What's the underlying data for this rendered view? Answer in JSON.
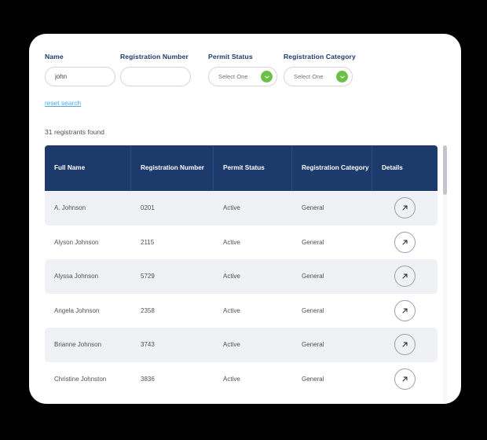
{
  "search": {
    "fields": [
      {
        "label": "Name",
        "type": "text",
        "value": "john",
        "placeholder": ""
      },
      {
        "label": "Registration Number",
        "type": "text",
        "value": "",
        "placeholder": ""
      },
      {
        "label": "Permit Status",
        "type": "select",
        "value": "Select One"
      },
      {
        "label": "Registration Category",
        "type": "select",
        "value": "Select One"
      }
    ],
    "reset_label": "reset search"
  },
  "results": {
    "count_text": "31 registrants found",
    "columns": [
      "Full Name",
      "Registration Number",
      "Permit Status",
      "Registration Category",
      "Details"
    ],
    "rows": [
      {
        "full_name": "A. Johnson",
        "registration_number": "0201",
        "permit_status": "Active",
        "registration_category": "General"
      },
      {
        "full_name": "Alyson Johnson",
        "registration_number": "2115",
        "permit_status": "Active",
        "registration_category": "General"
      },
      {
        "full_name": "Alyssa Johnson",
        "registration_number": "5729",
        "permit_status": "Active",
        "registration_category": "General"
      },
      {
        "full_name": "Angela Johnson",
        "registration_number": "2358",
        "permit_status": "Active",
        "registration_category": "General"
      },
      {
        "full_name": "Brianne Johnson",
        "registration_number": "3743",
        "permit_status": "Active",
        "registration_category": "General"
      },
      {
        "full_name": "Christine Johnston",
        "registration_number": "3836",
        "permit_status": "Active",
        "registration_category": "General"
      }
    ],
    "details_icon": "arrow-up-right-icon"
  },
  "icons": {
    "select_chevron": "chevron-down-icon"
  },
  "colors": {
    "header_navy": "#1d3a6d",
    "accent_green": "#6cc04a",
    "link_blue": "#49a9e8",
    "row_alt": "#f0f1f5",
    "page_background": "#000000"
  }
}
